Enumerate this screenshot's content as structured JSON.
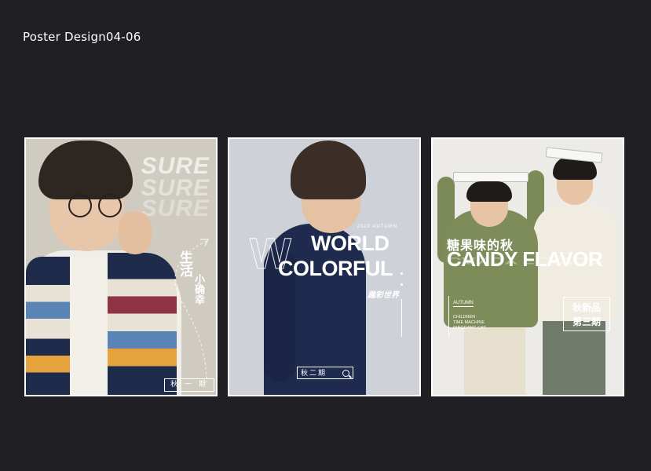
{
  "page": {
    "title": "Poster Design04-06"
  },
  "posters": [
    {
      "bg_words": [
        "SURE",
        "SURE",
        "SURE"
      ],
      "vertical_text": [
        "生活",
        "小确幸"
      ],
      "issue_label": "秋 一 期"
    },
    {
      "tag": "2020 AUTUMN",
      "big_letter": "W",
      "title_line1": "WORLD",
      "title_line2": "COLORFUL",
      "subtitle": "趣彩世界",
      "issue_label": "秋二期",
      "search_icon": "search-icon"
    },
    {
      "title_cn": "糖果味的秋",
      "title_en": "CANDY FLAVOR",
      "season": "AUTUMN",
      "lines": [
        "CHILDREN",
        "TIME MACHINE",
        "DINGDANG CAT"
      ],
      "box_line1": "秋新品",
      "box_line2": "第三期"
    }
  ]
}
